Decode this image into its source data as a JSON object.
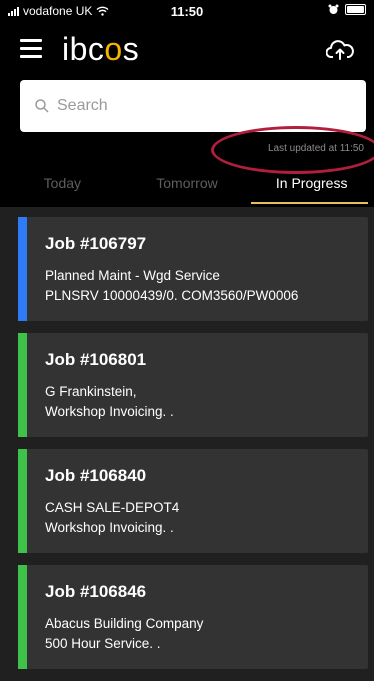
{
  "status_bar": {
    "carrier": "vodafone UK",
    "time": "11:50"
  },
  "app": {
    "logo_prefix": "ibc",
    "logo_o": "o",
    "logo_suffix": "s",
    "logo_accent_color": "#f5b400"
  },
  "search": {
    "placeholder": "Search",
    "value": ""
  },
  "last_updated": "Last updated at 11:50",
  "tabs": [
    {
      "label": "Today",
      "active": false
    },
    {
      "label": "Tomorrow",
      "active": false
    },
    {
      "label": "In Progress",
      "active": true
    }
  ],
  "jobs": [
    {
      "title": "Job #106797",
      "line1": "Planned Maint - Wgd Service",
      "line2": "PLNSRV 10000439/0. COM3560/PW0006",
      "color": "#2f7bf5"
    },
    {
      "title": "Job #106801",
      "line1": "G Frankinstein,",
      "line2": "Workshop Invoicing. .",
      "color": "#3fc24a"
    },
    {
      "title": "Job #106840",
      "line1": "CASH SALE-DEPOT4",
      "line2": "Workshop Invoicing. .",
      "color": "#3fc24a"
    },
    {
      "title": "Job #106846",
      "line1": "Abacus Building Company",
      "line2": "500 Hour Service. .",
      "color": "#3fc24a"
    }
  ]
}
